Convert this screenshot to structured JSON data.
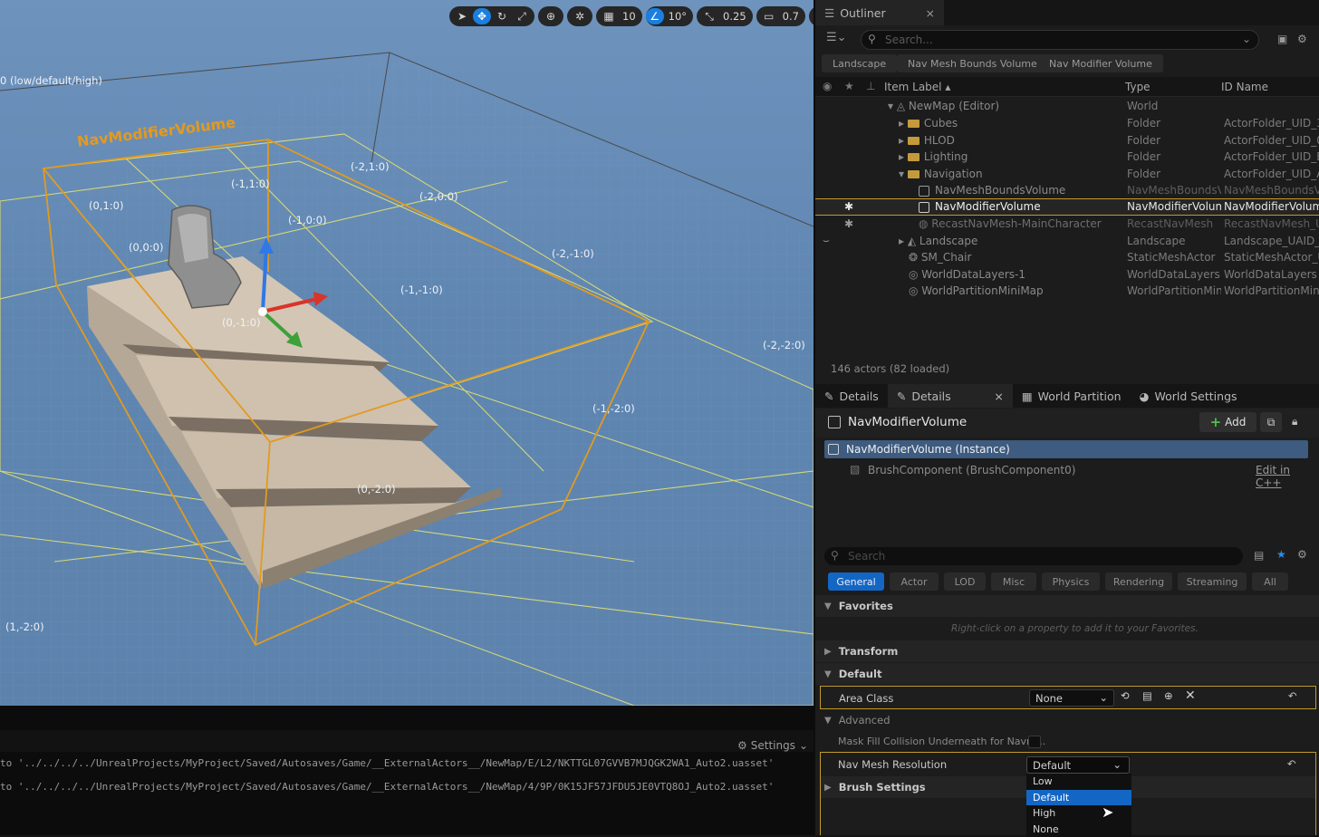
{
  "viewport": {
    "scalability_note": "0 (low/default/high)",
    "volume_label": "NavModifierVolume",
    "tile_labels": [
      "(0,1:0)",
      "(0,0:0)",
      "(-1,1:0)",
      "(-1,0:0)",
      "(-2,1:0)",
      "(-2,0:0)",
      "(-2,-1:0)",
      "(-1,-1:0)",
      "(0,-1:0)",
      "(-2,-2:0)",
      "(-1,-2:0)",
      "(0,-2:0)",
      "(1,-2:0)"
    ],
    "toolbar": {
      "grid": "10",
      "angle": "10°",
      "scale": "0.25",
      "camera_speed": "0.7"
    }
  },
  "console": {
    "settings_label": "Settings",
    "lines": [
      "to  '../../../../UnrealProjects/MyProject/Saved/Autosaves/Game/__ExternalActors__/NewMap/E/L2/NKTTGL07GVVB7MJQGK2WA1_Auto2.uasset'",
      "to  '../../../../UnrealProjects/MyProject/Saved/Autosaves/Game/__ExternalActors__/NewMap/4/9P/0K15JF57JFDU5JE0VTQ8OJ_Auto2.uasset'"
    ]
  },
  "outliner": {
    "title": "Outliner",
    "search_placeholder": "Search...",
    "chips": [
      "Landscape",
      "Nav Mesh Bounds Volume",
      "Nav Modifier Volume"
    ],
    "columns": {
      "label": "Item Label",
      "type": "Type",
      "id": "ID Name"
    },
    "rows": [
      {
        "label": "NewMap (Editor)",
        "type": "World",
        "id": ""
      },
      {
        "label": "Cubes",
        "type": "Folder",
        "id": "ActorFolder_UID_3"
      },
      {
        "label": "HLOD",
        "type": "Folder",
        "id": "ActorFolder_UID_0"
      },
      {
        "label": "Lighting",
        "type": "Folder",
        "id": "ActorFolder_UID_B"
      },
      {
        "label": "Navigation",
        "type": "Folder",
        "id": "ActorFolder_UID_A"
      },
      {
        "label": "NavMeshBoundsVolume",
        "type": "NavMeshBoundsV",
        "id": "NavMeshBoundsVo"
      },
      {
        "label": "NavModifierVolume",
        "type": "NavModifierVolume",
        "id": "NavModifierVolume"
      },
      {
        "label": "RecastNavMesh-MainCharacter",
        "type": "RecastNavMesh",
        "id": "RecastNavMesh_U"
      },
      {
        "label": "Landscape",
        "type": "Landscape",
        "id": "Landscape_UAID_/"
      },
      {
        "label": "SM_Chair",
        "type": "StaticMeshActor",
        "id": "StaticMeshActor_U"
      },
      {
        "label": "WorldDataLayers-1",
        "type": "WorldDataLayers",
        "id": "WorldDataLayers"
      },
      {
        "label": "WorldPartitionMiniMap",
        "type": "WorldPartitionMini",
        "id": "WorldPartitionMinil"
      }
    ],
    "status": "146 actors (82 loaded)"
  },
  "details": {
    "tabs": [
      "Details",
      "Details",
      "World Partition",
      "World Settings"
    ],
    "actor_name": "NavModifierVolume",
    "add_label": "Add",
    "instance_label": "NavModifierVolume (Instance)",
    "component_label": "BrushComponent (BrushComponent0)",
    "edit_link": "Edit in C++",
    "search_placeholder": "Search",
    "filter_tabs": [
      "General",
      "Actor",
      "LOD",
      "Misc",
      "Physics",
      "Rendering",
      "Streaming",
      "All"
    ],
    "favorites": {
      "title": "Favorites",
      "hint": "Right-click on a property to add it to your Favorites."
    },
    "transform": "Transform",
    "default_section": "Default",
    "area_class": {
      "label": "Area Class",
      "value": "None"
    },
    "advanced": "Advanced",
    "mask_fill": "Mask Fill Collision Underneath for Navm...",
    "nav_res": {
      "label": "Nav Mesh Resolution",
      "value": "Default"
    },
    "brush_settings": "Brush Settings",
    "menu_options": [
      "Low",
      "Default",
      "High",
      "None"
    ]
  }
}
